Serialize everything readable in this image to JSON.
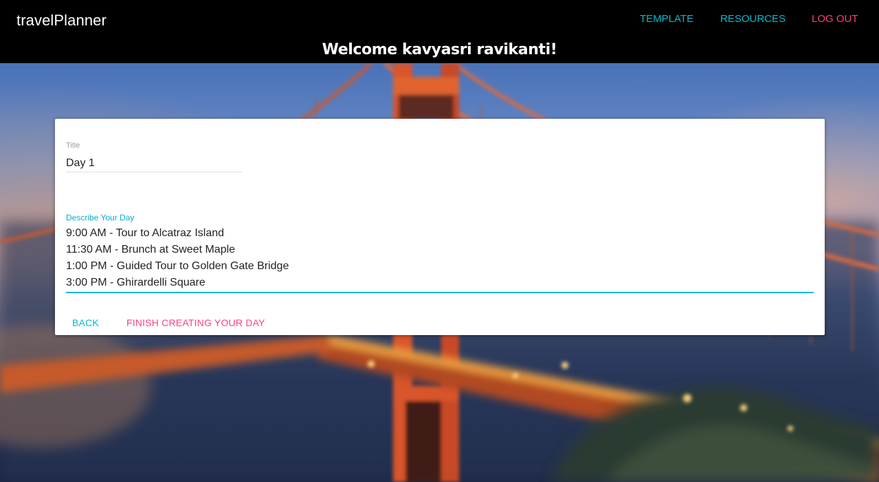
{
  "app": {
    "brand": "travelPlanner",
    "welcome": "Welcome kavyasri ravikanti!"
  },
  "nav": {
    "template": "TEMPLATE",
    "resources": "RESOURCES",
    "logout": "LOG OUT"
  },
  "form": {
    "title_label": "Title",
    "title_value": "Day 1",
    "description_label": "Describe Your Day",
    "description_lines": [
      "9:00 AM - Tour to Alcatraz Island",
      "11:30 AM - Brunch at Sweet Maple",
      "1:00 PM - Guided Tour to Golden Gate Bridge",
      "3:00 PM - Ghirardelli Square"
    ],
    "back_label": "BACK",
    "finish_label": "FINISH CREATING YOUR DAY"
  },
  "colors": {
    "accent_cyan": "#00bcd4",
    "accent_pink": "#ff4081",
    "header_bg": "#000000"
  }
}
